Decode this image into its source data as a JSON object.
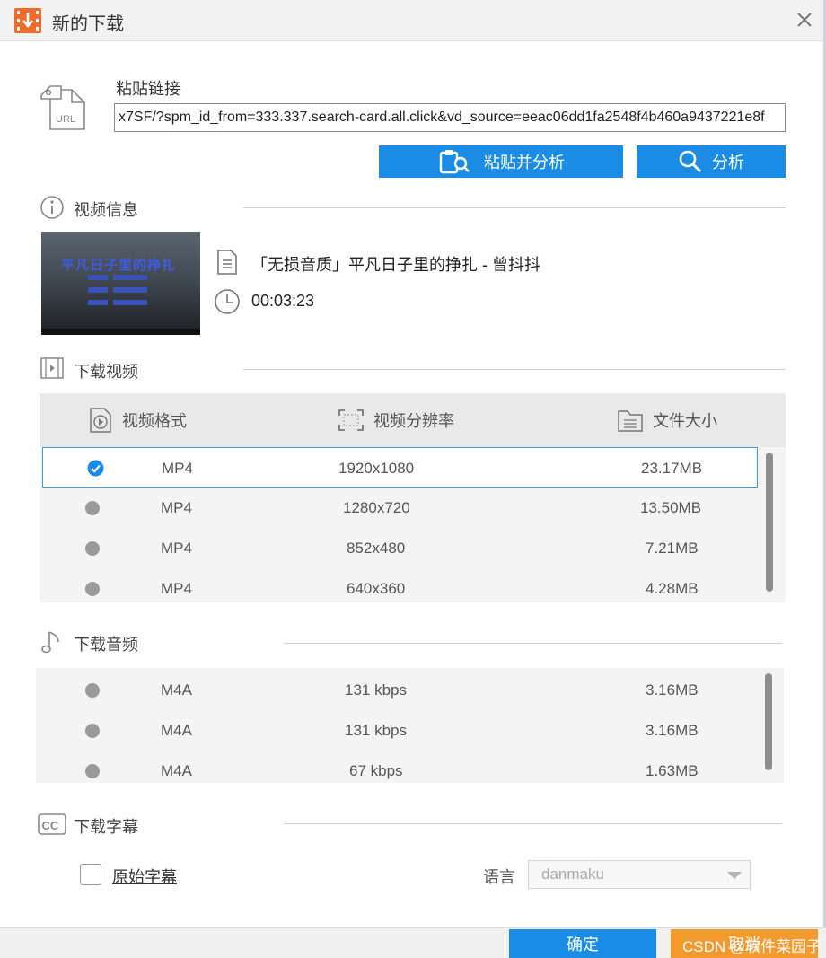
{
  "window": {
    "title": "新的下载"
  },
  "paste": {
    "label": "粘贴链接",
    "url_value": "x7SF/?spm_id_from=333.337.search-card.all.click&vd_source=eeac06dd1fa2548f4b460a9437221e8f",
    "paste_analyze_label": "粘贴并分析",
    "analyze_label": "分析"
  },
  "video_info": {
    "section_title": "视频信息",
    "title": "「无损音质」平凡日子里的挣扎 - 曾抖抖",
    "duration": "00:03:23",
    "thumbnail_text": "平凡日子里的挣扎"
  },
  "download_video": {
    "section_title": "下载视频",
    "columns": [
      "视频格式",
      "视频分辨率",
      "文件大小"
    ],
    "rows": [
      {
        "format": "MP4",
        "resolution": "1920x1080",
        "size": "23.17MB",
        "selected": true
      },
      {
        "format": "MP4",
        "resolution": "1280x720",
        "size": "13.50MB",
        "selected": false
      },
      {
        "format": "MP4",
        "resolution": "852x480",
        "size": "7.21MB",
        "selected": false
      },
      {
        "format": "MP4",
        "resolution": "640x360",
        "size": "4.28MB",
        "selected": false
      }
    ]
  },
  "download_audio": {
    "section_title": "下载音频",
    "rows": [
      {
        "format": "M4A",
        "bitrate": "131 kbps",
        "size": "3.16MB"
      },
      {
        "format": "M4A",
        "bitrate": "131 kbps",
        "size": "3.16MB"
      },
      {
        "format": "M4A",
        "bitrate": "67 kbps",
        "size": "1.63MB"
      }
    ]
  },
  "download_subtitle": {
    "section_title": "下载字幕",
    "original_subtitle_label": "原始字幕",
    "language_label": "语言",
    "language_value": "danmaku"
  },
  "footer": {
    "ok_label": "确定",
    "cancel_label": "取消",
    "watermark": "CSDN @软件菜园子"
  },
  "colors": {
    "accent": "#1a8ce6",
    "cancel": "#f39a2e",
    "app_icon": "#f06a2a"
  }
}
